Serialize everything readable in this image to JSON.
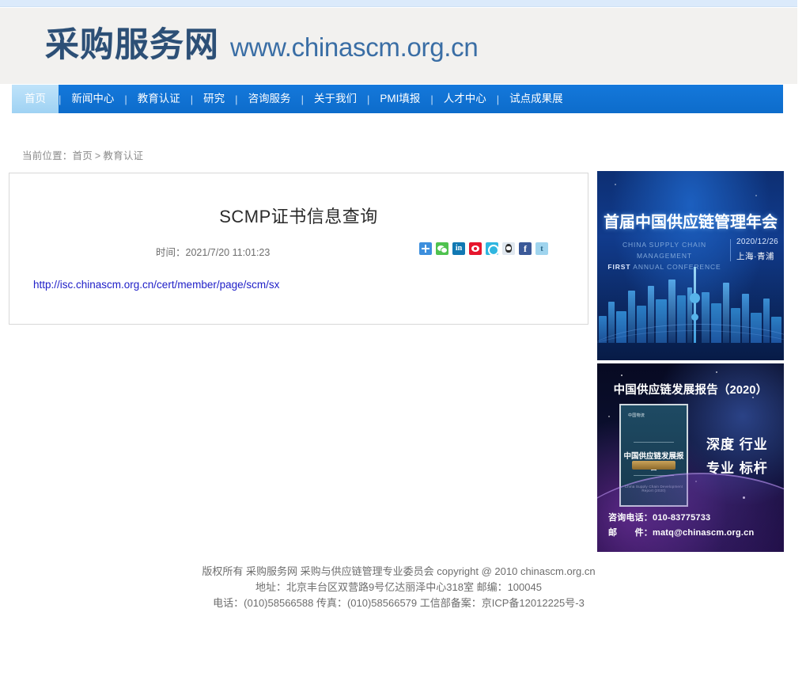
{
  "site": {
    "logo_cn": "采购服务网",
    "logo_url": "www.chinascm.org.cn"
  },
  "nav": {
    "items": [
      {
        "label": "首页",
        "active": true
      },
      {
        "label": "新闻中心",
        "active": false
      },
      {
        "label": "教育认证",
        "active": false
      },
      {
        "label": "研究",
        "active": false
      },
      {
        "label": "咨询服务",
        "active": false
      },
      {
        "label": "关于我们",
        "active": false
      },
      {
        "label": "PMI填报",
        "active": false
      },
      {
        "label": "人才中心",
        "active": false
      },
      {
        "label": "试点成果展",
        "active": false
      }
    ],
    "separator": "|"
  },
  "breadcrumb": {
    "prefix": "当前位置：",
    "home": "首页",
    "separator": ">",
    "current": "教育认证"
  },
  "article": {
    "title": "SCMP证书信息查询",
    "time_label": "时间：",
    "time_value": "2021/7/20 11:01:23",
    "link_text": "http://isc.chinascm.org.cn/cert/member/page/scm/sx",
    "link_color": "#2020c8"
  },
  "share": {
    "icons": [
      {
        "name": "jiathis-share-icon",
        "label": ""
      },
      {
        "name": "wechat-share-icon",
        "label": ""
      },
      {
        "name": "linkedin-share-icon",
        "label": "in"
      },
      {
        "name": "weibo-share-icon",
        "label": ""
      },
      {
        "name": "pinterest-share-icon",
        "label": ""
      },
      {
        "name": "qq-share-icon",
        "label": ""
      },
      {
        "name": "facebook-share-icon",
        "label": "f"
      },
      {
        "name": "twitter-share-icon",
        "label": "t"
      }
    ]
  },
  "banners": {
    "conference": {
      "title": "首届中国供应链管理年会",
      "subtitle_line1": "CHINA SUPPLY CHAIN MANAGEMENT",
      "subtitle_line2_bold": "FIRST",
      "subtitle_line2_rest": " ANNUAL CONFERENCE",
      "date": "2020/12/26",
      "place": "上海·青浦"
    },
    "report": {
      "title": "中国供应链发展报告（2020）",
      "book_logo": "中国物流",
      "book_title": "中国供应链发展报告",
      "book_sub": "China Supply Chain Development Report (2020)",
      "slogan_line1": "深度  行业",
      "slogan_line2": "专业  标杆",
      "phone": "咨询电话：010-83775733",
      "email": "邮　　件：matq@chinascm.org.cn"
    }
  },
  "footer": {
    "line1": "版权所有 采购服务网 采购与供应链管理专业委员会 copyright @ 2010 chinascm.org.cn",
    "line2": "地址：北京丰台区双营路9号亿达丽泽中心318室 邮编：100045",
    "line3": "电话：(010)58566588 传真：(010)58566579 工信部备案：京ICP备12012225号-3"
  }
}
